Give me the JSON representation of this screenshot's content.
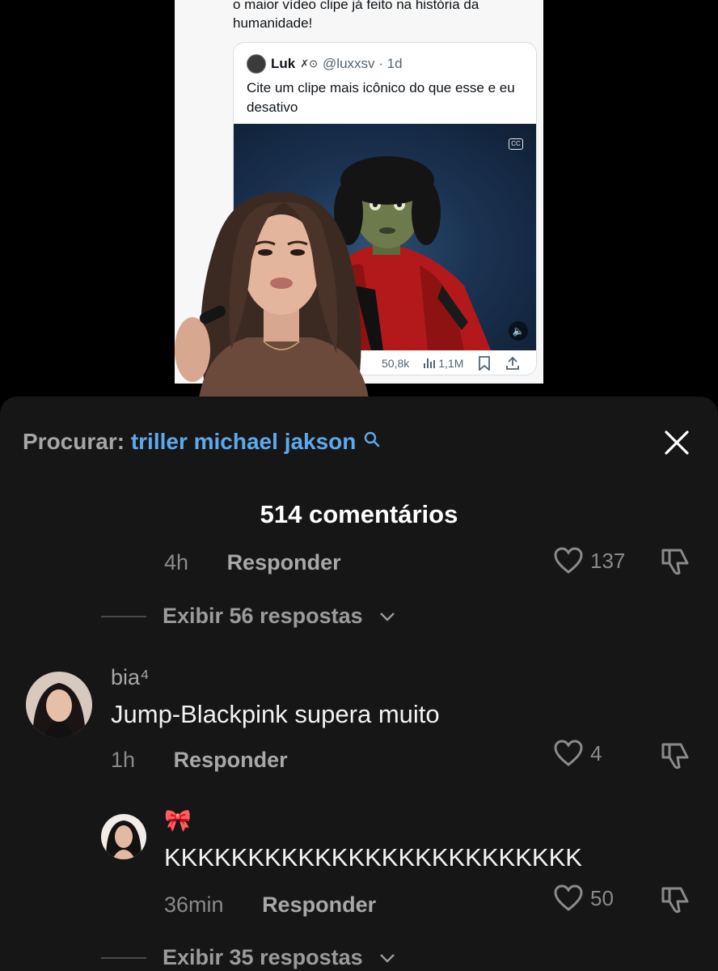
{
  "video": {
    "tweet_text": "o maior vídeo clipe já feito na história da humanidade!",
    "quote": {
      "name": "Luk",
      "badge": "✗⊙",
      "handle": "@luxxsv · 1d",
      "text": "Cite um clipe mais icônico do que esse e eu desativo"
    },
    "tweet_stats": {
      "likes": "50,8k",
      "views": "1,1M"
    }
  },
  "sheet": {
    "search_prefix": "Procurar:",
    "search_query": "triller michael jakson",
    "comments_count": "514 comentários",
    "prev_comment": {
      "time": "4h",
      "reply_label": "Responder",
      "likes": "137"
    },
    "view_replies_1": "Exibir 56 respostas",
    "comment": {
      "username": "bia⁴",
      "text": "Jump-Blackpink supera muito",
      "time": "1h",
      "reply_label": "Responder",
      "likes": "4"
    },
    "reply": {
      "username": "🎀",
      "text": "KKKKKKKKKKKKKKKKKKKKKKKKK",
      "time": "36min",
      "reply_label": "Responder",
      "likes": "50"
    },
    "view_replies_2": "Exibir 35 respostas"
  },
  "colors": {
    "sheet_bg": "#161616",
    "search_query": "#5ea8ec",
    "muted_text": "#8a8a8a"
  }
}
